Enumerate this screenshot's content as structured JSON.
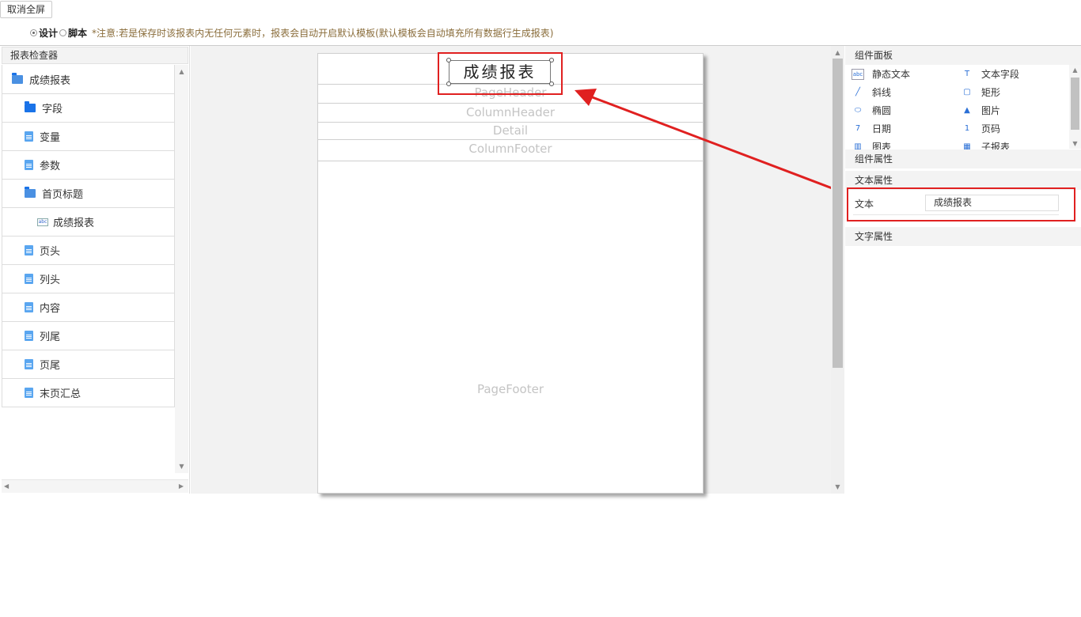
{
  "toolbar": {
    "exit_fullscreen": "取消全屏"
  },
  "mode": {
    "design": "设计",
    "script": "脚本",
    "selected": "设计",
    "note": "*注意:若是保存时该报表内无任何元素时，报表会自动开启默认模板(默认模板会自动填充所有数据行生成报表)"
  },
  "inspector": {
    "title": "报表检查器",
    "items": [
      {
        "label": "成绩报表",
        "icon": "folder-open-icon",
        "indent": 0
      },
      {
        "label": "字段",
        "icon": "folder-icon",
        "indent": 1
      },
      {
        "label": "变量",
        "icon": "file-icon",
        "indent": 1
      },
      {
        "label": "参数",
        "icon": "file-icon",
        "indent": 1
      },
      {
        "label": "首页标题",
        "icon": "folder-open-icon",
        "indent": 1
      },
      {
        "label": "成绩报表",
        "icon": "abc-text-icon",
        "indent": 2
      },
      {
        "label": "页头",
        "icon": "file-icon",
        "indent": 1
      },
      {
        "label": "列头",
        "icon": "file-icon",
        "indent": 1
      },
      {
        "label": "内容",
        "icon": "file-icon",
        "indent": 1
      },
      {
        "label": "列尾",
        "icon": "file-icon",
        "indent": 1
      },
      {
        "label": "页尾",
        "icon": "file-icon",
        "indent": 1
      },
      {
        "label": "末页汇总",
        "icon": "file-icon",
        "indent": 1
      }
    ]
  },
  "canvas": {
    "title_text": "成绩报表",
    "bands": [
      "PageHeader",
      "ColumnHeader",
      "Detail",
      "ColumnFooter",
      "PageFooter"
    ]
  },
  "components": {
    "title": "组件面板",
    "items": [
      {
        "label": "静态文本",
        "icon": "static-text-icon"
      },
      {
        "label": "文本字段",
        "icon": "text-field-icon"
      },
      {
        "label": "斜线",
        "icon": "diagonal-line-icon"
      },
      {
        "label": "矩形",
        "icon": "rectangle-icon"
      },
      {
        "label": "椭圆",
        "icon": "ellipse-icon"
      },
      {
        "label": "图片",
        "icon": "image-icon"
      },
      {
        "label": "日期",
        "icon": "calendar-icon"
      },
      {
        "label": "页码",
        "icon": "page-number-icon"
      },
      {
        "label": "图表",
        "icon": "chart-icon"
      },
      {
        "label": "子报表",
        "icon": "subreport-icon"
      }
    ]
  },
  "properties": {
    "component_props": "组件属性",
    "text_props": "文本属性",
    "text_label": "文本",
    "text_value": "成绩报表",
    "font_props": "文字属性"
  },
  "colors": {
    "highlight": "#e02020",
    "folder": "#1a73e8",
    "file": "#5aa6f0"
  }
}
